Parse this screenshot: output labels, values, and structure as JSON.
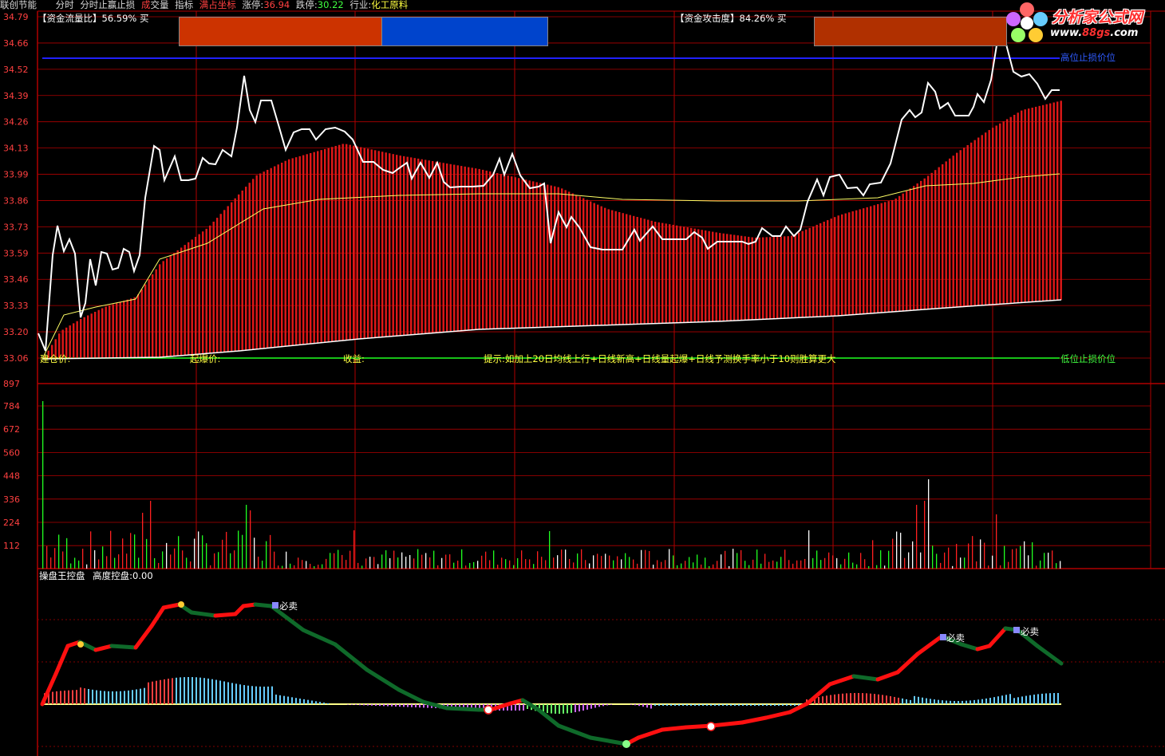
{
  "header": {
    "stock_name": "联创节能",
    "tabs": [
      "分时",
      "分时止赢止损"
    ],
    "volume_label_left": "成",
    "volume_label_right": "交量",
    "indicator_label": "指标",
    "full_coords_label": "满占坐标",
    "limit_up_label": "涨停:",
    "limit_up_value": "36.94",
    "limit_down_label": "跌停:",
    "limit_down_value": "30.22",
    "industry_label": "行业:",
    "industry_value": "化工原料"
  },
  "logo": {
    "title": "分析家公式网",
    "url_prefix": "www.",
    "url_highlight": "88gs",
    "url_suffix": ".com"
  },
  "price_panel": {
    "fund_flow_label": "【资金流量比】",
    "fund_flow_value": "56.59% 买",
    "attack_label": "【资金攻击度】",
    "attack_value": "84.26% 买",
    "y_ticks": [
      "34.79",
      "34.66",
      "34.52",
      "34.39",
      "34.26",
      "34.13",
      "33.99",
      "33.86",
      "33.73",
      "33.59",
      "33.46",
      "33.33",
      "33.20",
      "33.06"
    ],
    "high_stop_label": "高位止损价位",
    "low_stop_label": "低位止损价位",
    "buy_label": "建仓价:",
    "breakout_label": "起爆价:",
    "profit_label": "收益:",
    "hint_text": "提示:如加上20日均线上行+日线新高+日线量起爆+日线予测换手率小于10则胜算更大"
  },
  "volume_panel": {
    "y_ticks": [
      "897",
      "784",
      "672",
      "560",
      "448",
      "336",
      "224",
      "112"
    ]
  },
  "indicator_panel": {
    "title": "操盘王控盘",
    "height_label": "高度控盘:",
    "height_value": "0.00",
    "sell_label": "必卖"
  },
  "colors": {
    "grid": "#b00000",
    "up": "#ff2020",
    "down": "#20ff20",
    "price_line": "#ffffff",
    "avg_line": "#ffff66",
    "high_stop_line": "#2020ff",
    "low_stop_line": "#20ff20",
    "fund_bar_red": "#cc3300",
    "fund_bar_blue": "#0044cc",
    "attack_bar": "#b03000"
  }
}
